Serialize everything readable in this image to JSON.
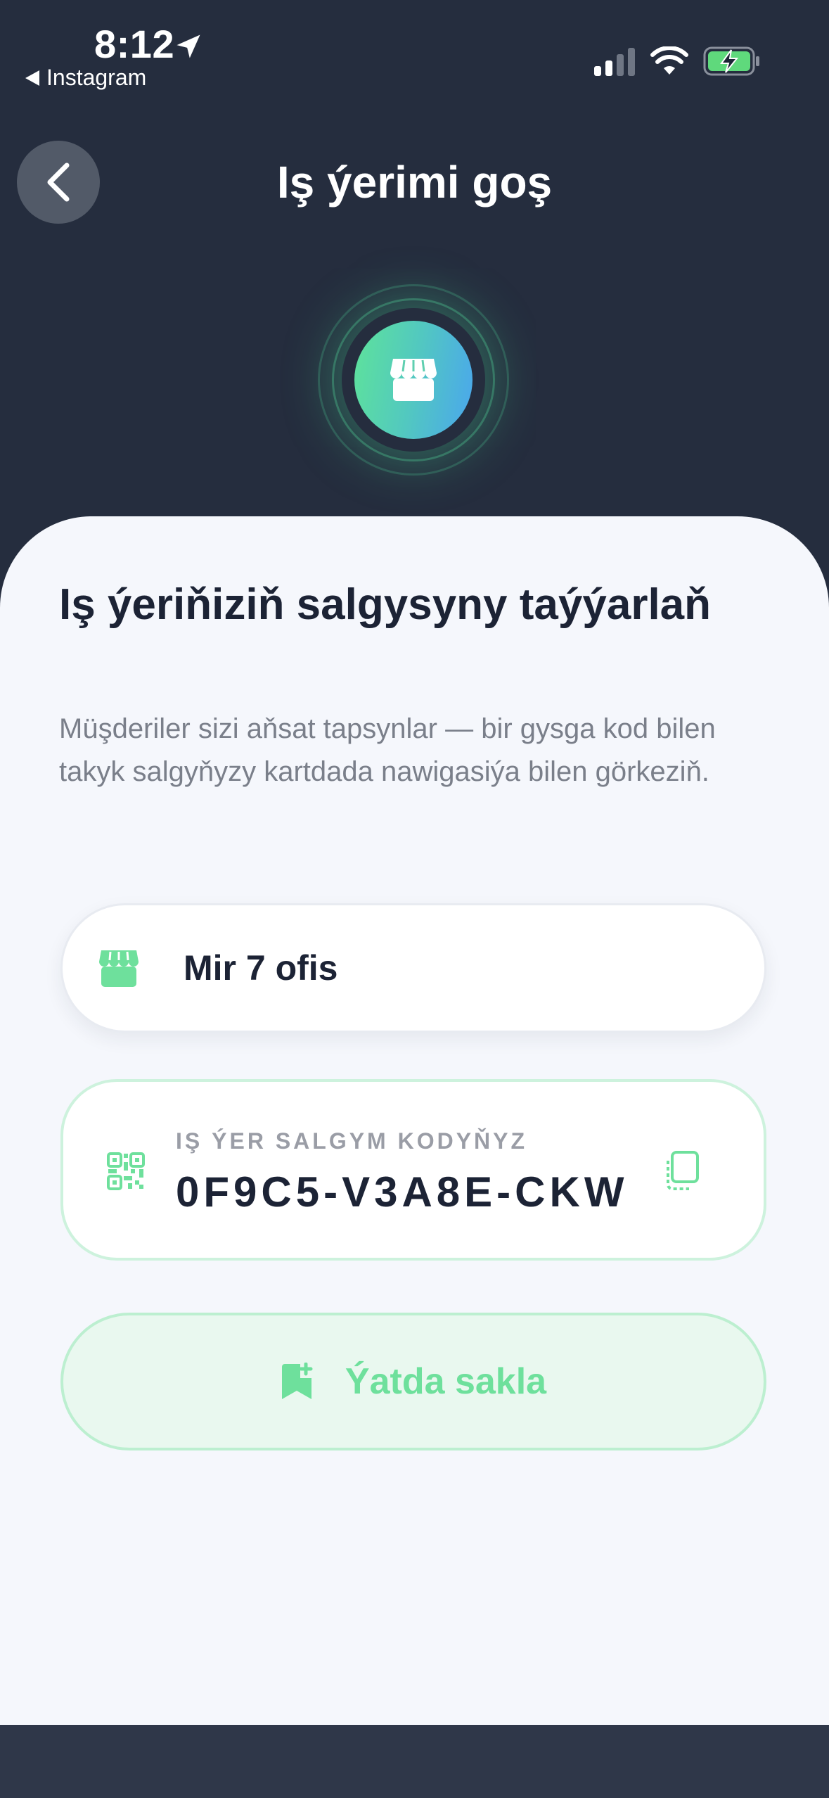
{
  "status_bar": {
    "time": "8:12",
    "back_app": "Instagram"
  },
  "header": {
    "title": "Iş ýerimi goş"
  },
  "content": {
    "heading": "Iş ýeriňiziň salgysyny taýýarlaň",
    "description": "Müşderiler sizi aňsat tapsynlar — bir gysga kod bilen takyk salgyňyzy kartdada nawigasiýa bilen görkeziň.",
    "workplace_name": "Mir 7 ofis",
    "code_label": "IŞ ÝER SALGYM KODYŇYZ",
    "code_value": "0F9C5-V3A8E-CKW",
    "save_label": "Ýatda sakla"
  },
  "colors": {
    "background": "#252d3e",
    "sheet": "#f5f7fc",
    "accent_green": "#6ee09c",
    "text_dark": "#1c2335"
  },
  "icons": [
    "location-arrow-icon",
    "signal-icon",
    "wifi-icon",
    "battery-charging-icon",
    "back-chevron-icon",
    "store-icon",
    "qr-code-icon",
    "copy-icon",
    "bookmark-add-icon"
  ]
}
